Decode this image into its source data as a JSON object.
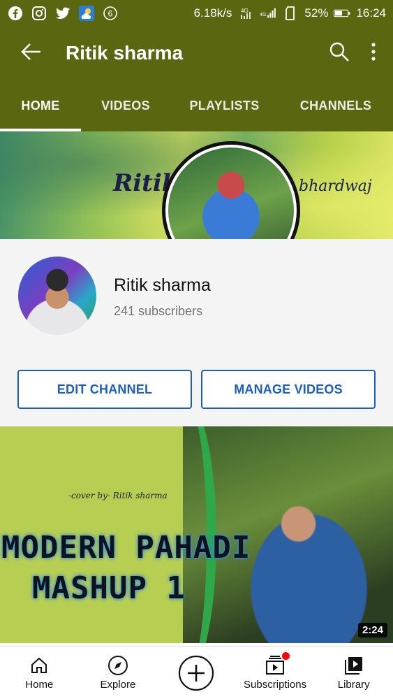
{
  "status_bar": {
    "notification_count": "6",
    "network_speed": "6.18k/s",
    "signal_label_1": "4G",
    "signal_label_2": "4G",
    "battery": "52%",
    "time": "16:24"
  },
  "app_bar": {
    "title": "Ritik sharma"
  },
  "tabs": [
    {
      "label": "HOME",
      "active": true
    },
    {
      "label": "VIDEOS",
      "active": false
    },
    {
      "label": "PLAYLISTS",
      "active": false
    },
    {
      "label": "CHANNELS",
      "active": false
    }
  ],
  "banner": {
    "text_left": "Ritik",
    "text_right": "bhardwaj"
  },
  "channel": {
    "name": "Ritik sharma",
    "subscribers": "241 subscribers",
    "edit_label": "EDIT CHANNEL",
    "manage_label": "MANAGE VIDEOS"
  },
  "video": {
    "credit": "-cover by- Ritik sharma",
    "title_line_1": "MODERN PAHADI",
    "title_line_2": "MASHUP  1",
    "duration": "2:24"
  },
  "bottom_nav": [
    {
      "label": "Home",
      "icon": "home-icon"
    },
    {
      "label": "Explore",
      "icon": "compass-icon"
    },
    {
      "label": "",
      "icon": "create-icon"
    },
    {
      "label": "Subscriptions",
      "icon": "subscriptions-icon"
    },
    {
      "label": "Library",
      "icon": "library-icon"
    }
  ],
  "colors": {
    "header_bg": "#5b6710",
    "button_blue": "#1a5fc1",
    "notification_red": "#ff0000"
  }
}
